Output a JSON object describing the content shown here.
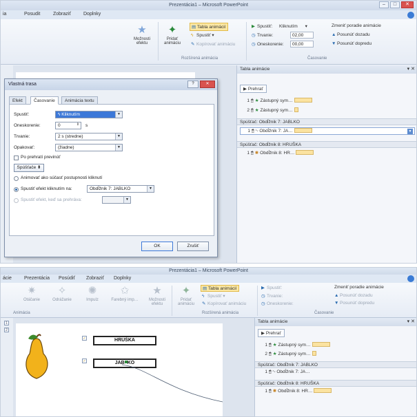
{
  "shot1": {
    "window_title": "Prezentácia1 – Microsoft PowerPoint",
    "tabs": [
      "ia",
      "Posudit",
      "Zobraziť",
      "Doplnky"
    ],
    "ribbon": {
      "effect_options": "Možnosti efektu",
      "add_animation": "Pridať animáciu",
      "animation_pane": "Tabla animácií",
      "trigger": "Spustiť",
      "copy_animation": "Kopírovať animáciu",
      "group_advanced": "Rozšírená animácia",
      "start_label": "Spustiť:",
      "start_value": "Kliknutím",
      "duration_label": "Trvanie:",
      "duration_value": "02,00",
      "delay_label": "Oneskorenie:",
      "delay_value": "00,00",
      "reorder": "Zmeniť poradie animácie",
      "move_earlier": "Posunúť dozadu",
      "move_later": "Posunúť dopredu",
      "group_timing": "Časovanie"
    },
    "pane": {
      "title": "Tabla animácie",
      "play": "Prehrať",
      "items": [
        {
          "num": "1",
          "text": "Zástupný sym…"
        },
        {
          "num": "2",
          "text": "Zástupný sym…"
        }
      ],
      "trigger1": "Spúšťač: Obdĺžnik 7: JABLKO",
      "trigger1_item": {
        "num": "1",
        "text": "Obdĺžnik 7: JA…"
      },
      "trigger2": "Spúšťač: Obdĺžnik 8: HRUŠKA",
      "trigger2_item": {
        "num": "1",
        "text": "Obdĺžnik 8: HR…"
      }
    },
    "dialog": {
      "title": "Vlastná trasa",
      "tabs": [
        "Efekt",
        "Časovanie",
        "Animácia textu"
      ],
      "start_label": "Spustiť:",
      "start_value": "Kliknutím",
      "delay_label": "Oneskorenie:",
      "delay_value": "0",
      "delay_unit": "s",
      "duration_label": "Trvanie:",
      "duration_value": "2 s (stredne)",
      "repeat_label": "Opakovať:",
      "repeat_value": "(žiadne)",
      "rewind_label": "Po prehratí previnúť",
      "triggers_button": "Spúšťače",
      "option1": "Animovať ako súčasť postupnosti kliknutí",
      "option2": "Spustiť efekt kliknutím na:",
      "option2_value": "Obdĺžnik 7: JABLKO",
      "option3": "Spustiť efekt, keď sa prehráva:",
      "ok": "OK",
      "cancel": "Zrušiť"
    }
  },
  "shot2": {
    "window_title": "Prezentácia1 – Microsoft PowerPoint",
    "tabs": [
      "ácie",
      "Prezentácia",
      "Posúdiť",
      "Zobraziť",
      "Doplnky"
    ],
    "ribbon": {
      "effects": [
        "Otáčanie",
        "Odrážanie",
        "Impulz",
        "Farebný imp…"
      ],
      "effect_options": "Možnosti efektu",
      "group_animation": "Animácia",
      "add_animation": "Pridať animáciu",
      "animation_pane": "Tabla animácií",
      "trigger": "Spustiť",
      "copy_animation": "Kopírovať animáciu",
      "group_advanced": "Rozšírená animácia",
      "start_label": "Spustiť:",
      "duration_label": "Trvanie:",
      "delay_label": "Oneskorenie:",
      "reorder": "Zmeniť poradie animácie",
      "move_earlier": "Posunúť dozadu",
      "move_later": "Posunúť dopredu",
      "group_timing": "Časovanie"
    },
    "slide": {
      "box1": "HRUŠKA",
      "box2_a": "JAB",
      "box2_b": "KO"
    },
    "pane": {
      "title": "Tabla animácie",
      "play": "Prehrať",
      "items": [
        {
          "num": "1",
          "text": "Zástupný sym…"
        },
        {
          "num": "2",
          "text": "Zástupný sym…"
        }
      ],
      "trigger1": "Spúšťač: Obdĺžnik 7: JABLKO",
      "trigger1_item": {
        "num": "1",
        "text": "Obdĺžnik 7: JA…"
      },
      "trigger2": "Spúšťač: Obdĺžnik 8: HRUŠKA",
      "trigger2_item": {
        "num": "1",
        "text": "Obdĺžnik 8: HR…"
      }
    }
  },
  "colors": {
    "accent": "#3c78d8",
    "timing_bar": "#fbe3a1",
    "pear": "#f2b21b"
  }
}
